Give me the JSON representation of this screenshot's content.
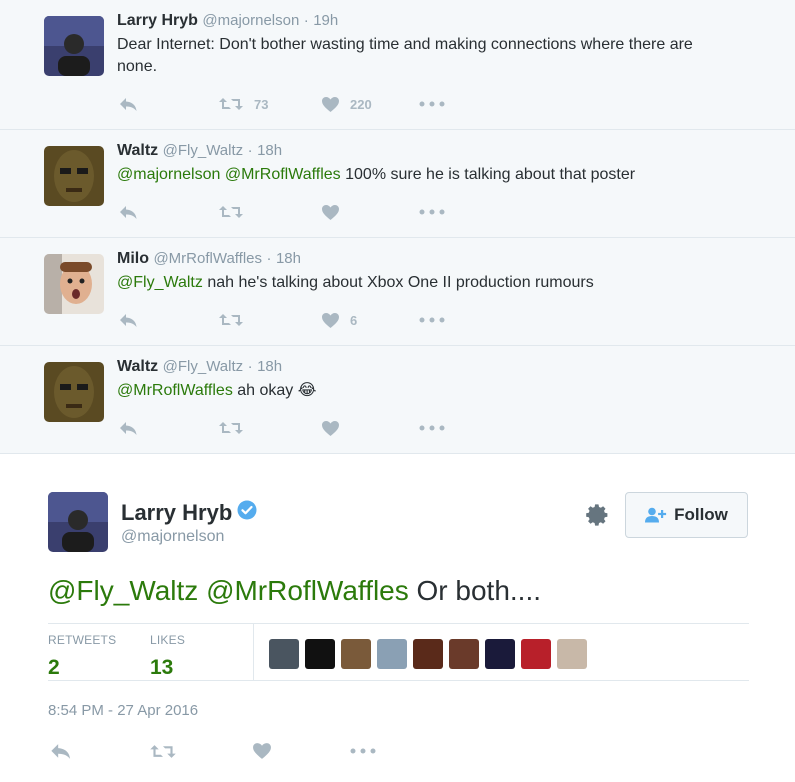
{
  "replies": [
    {
      "name": "Larry Hryb",
      "handle": "@majornelson",
      "dot": "·",
      "time": "19h",
      "text": [
        {
          "t": "Dear Internet: Don't bother wasting time and making connections where there are none.",
          "mention": false
        }
      ],
      "retweets": "73",
      "likes": "220",
      "avatar_color": "#3a3f6e"
    },
    {
      "name": "Waltz",
      "handle": "@Fly_Waltz",
      "dot": "·",
      "time": "18h",
      "text": [
        {
          "t": "@majornelson",
          "mention": true
        },
        {
          "t": " ",
          "mention": false
        },
        {
          "t": "@MrRoflWaffles",
          "mention": true
        },
        {
          "t": " 100% sure he is talking about that poster",
          "mention": false
        }
      ],
      "retweets": "",
      "likes": "",
      "avatar_color": "#6b5a2c"
    },
    {
      "name": "Milo",
      "handle": "@MrRoflWaffles",
      "dot": "·",
      "time": "18h",
      "text": [
        {
          "t": "@Fly_Waltz",
          "mention": true
        },
        {
          "t": " nah he's talking about Xbox One II production rumours",
          "mention": false
        }
      ],
      "retweets": "",
      "likes": "6",
      "avatar_color": "#c99a7a"
    },
    {
      "name": "Waltz",
      "handle": "@Fly_Waltz",
      "dot": "·",
      "time": "18h",
      "text": [
        {
          "t": "@MrRoflWaffles",
          "mention": true
        },
        {
          "t": " ah okay 😂",
          "mention": false
        }
      ],
      "retweets": "",
      "likes": "",
      "avatar_color": "#6b5a2c"
    }
  ],
  "main": {
    "fullname": "Larry Hryb",
    "screenname": "@majornelson",
    "follow_label": "Follow",
    "text": [
      {
        "t": "@Fly_Waltz",
        "mention": true
      },
      {
        "t": " ",
        "mention": false
      },
      {
        "t": "@MrRoflWaffles",
        "mention": true
      },
      {
        "t": " Or both....",
        "mention": false
      }
    ],
    "retweets_label": "RETWEETS",
    "retweets": "2",
    "likes_label": "LIKES",
    "likes": "13",
    "timestamp": "8:54 PM - 27 Apr 2016",
    "likers": [
      {
        "name": "liker-1",
        "color": "#4a5560"
      },
      {
        "name": "liker-2",
        "color": "#111111"
      },
      {
        "name": "liker-3",
        "color": "#7a5a3a"
      },
      {
        "name": "liker-4",
        "color": "#8aa0b4"
      },
      {
        "name": "liker-5",
        "color": "#5a2a1a"
      },
      {
        "name": "liker-6",
        "color": "#6a3a2a"
      },
      {
        "name": "liker-7",
        "color": "#1a1a3a"
      },
      {
        "name": "liker-8",
        "color": "#b8202a"
      },
      {
        "name": "liker-9",
        "color": "#c8b8a8"
      }
    ]
  },
  "colors": {
    "mention": "#2b7a0b",
    "muted": "#8899a6",
    "action": "#aab8c2",
    "verified": "#55acee"
  },
  "icons": {
    "reply": "reply-icon",
    "retweet": "retweet-icon",
    "like": "heart-icon",
    "more": "more-icon",
    "gear": "gear-icon",
    "follow": "follow-person-icon",
    "verified": "verified-badge-icon"
  }
}
